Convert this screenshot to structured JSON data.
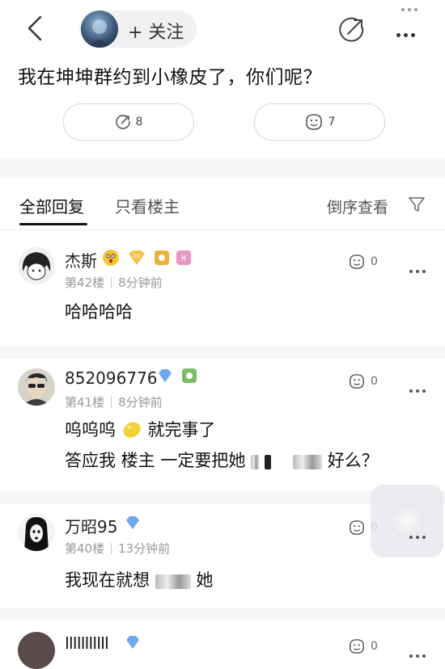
{
  "header": {
    "follow_label": "+ 关注"
  },
  "post": {
    "title": "我在坤坤群约到小橡皮了，你们呢？",
    "share_count": "8",
    "reaction_count": "7"
  },
  "tabs": {
    "all_replies": "全部回复",
    "op_only": "只看楼主",
    "sort": "倒序查看"
  },
  "comments": [
    {
      "name": "杰斯",
      "floor": "第42楼",
      "time": "8分钟前",
      "body_lines": [
        "哈哈哈哈"
      ],
      "likes": "0"
    },
    {
      "name": "852096776",
      "floor": "第41楼",
      "time": "8分钟前",
      "body_lines": [
        "呜呜呜",
        "就完事了",
        "答应我 楼主 一定要把她",
        "好么？"
      ],
      "likes": "0"
    },
    {
      "name": "万昭95",
      "floor": "第40楼",
      "time": "13分钟前",
      "body_lines": [
        "我现在就想",
        "她"
      ],
      "likes": "0"
    },
    {
      "name": "IIIIIIIIIII",
      "likes": "0"
    }
  ],
  "colors": {
    "accent_blue": "#6fa8f0",
    "divider_gray": "#f6f6f6",
    "meta_gray": "#999999"
  }
}
